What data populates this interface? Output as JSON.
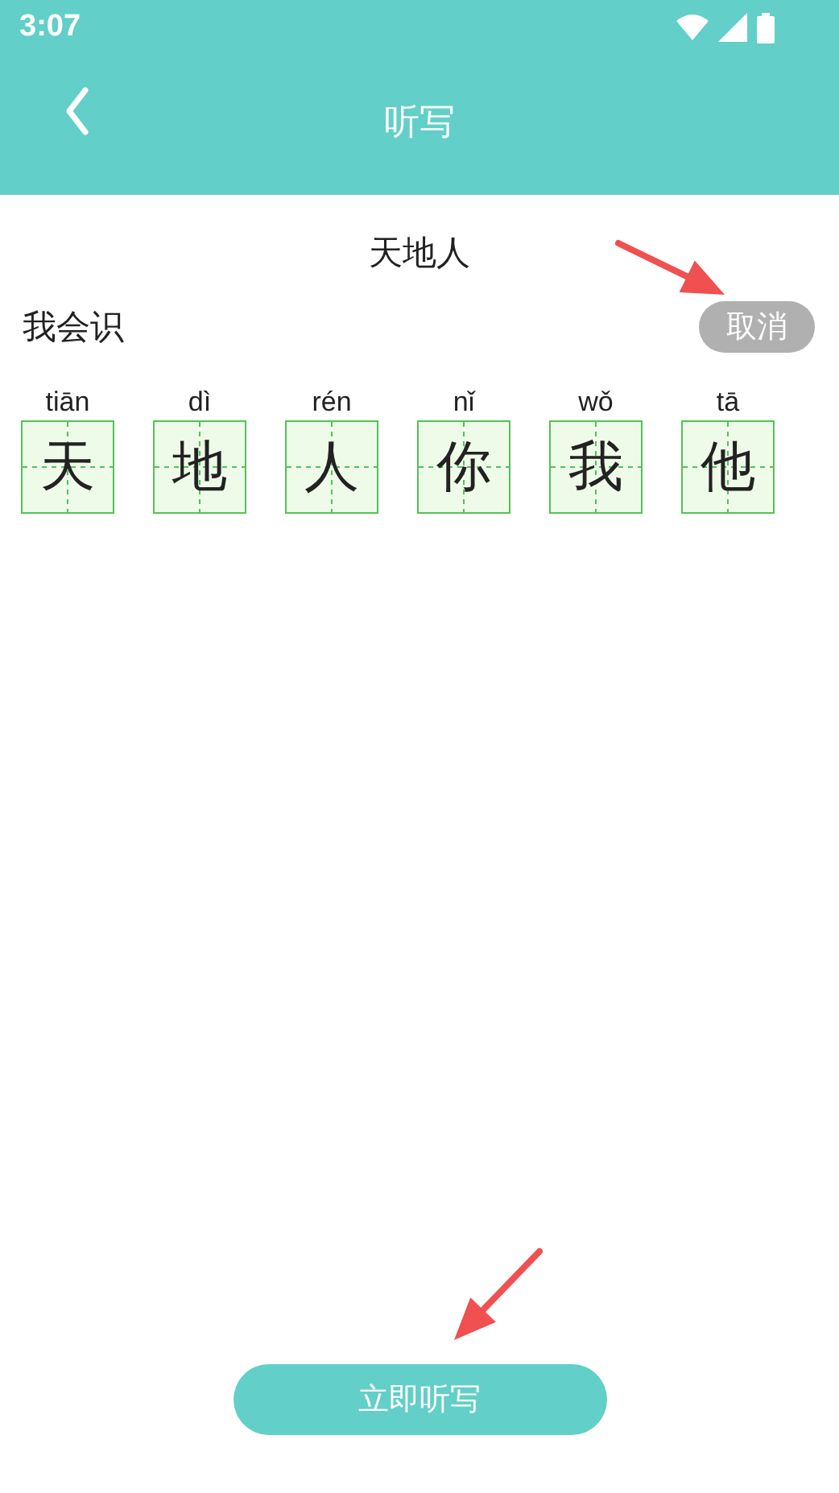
{
  "status_bar": {
    "time": "3:07"
  },
  "header": {
    "title": "听写"
  },
  "lesson_title": "天地人",
  "section": {
    "label": "我会识",
    "cancel_button": "取消"
  },
  "characters": [
    {
      "pinyin": "tiān",
      "hanzi": "天"
    },
    {
      "pinyin": "dì",
      "hanzi": "地"
    },
    {
      "pinyin": "rén",
      "hanzi": "人"
    },
    {
      "pinyin": "nǐ",
      "hanzi": "你"
    },
    {
      "pinyin": "wǒ",
      "hanzi": "我"
    },
    {
      "pinyin": "tā",
      "hanzi": "他"
    }
  ],
  "action_button": "立即听写"
}
